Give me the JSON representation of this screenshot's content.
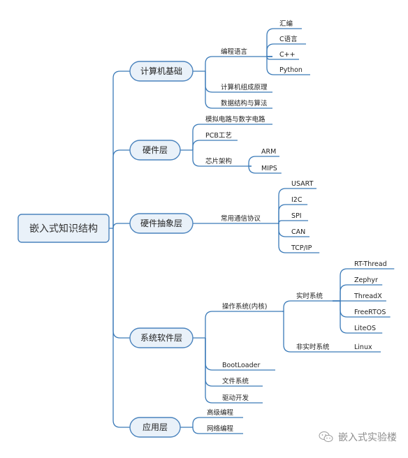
{
  "root": {
    "label": "嵌入式知识结构"
  },
  "branches": [
    {
      "label": "计算机基础",
      "children": [
        {
          "label": "编程语言",
          "children": [
            {
              "label": "汇编"
            },
            {
              "label": "C语言"
            },
            {
              "label": "C++"
            },
            {
              "label": "Python"
            }
          ]
        },
        {
          "label": "计算机组成原理"
        },
        {
          "label": "数据结构与算法"
        }
      ]
    },
    {
      "label": "硬件层",
      "children": [
        {
          "label": "模拟电路与数字电路"
        },
        {
          "label": "PCB工艺"
        },
        {
          "label": "芯片架构",
          "children": [
            {
              "label": "ARM"
            },
            {
              "label": "MIPS"
            }
          ]
        }
      ]
    },
    {
      "label": "硬件抽象层",
      "children": [
        {
          "label": "常用通信协议",
          "children": [
            {
              "label": "USART"
            },
            {
              "label": "I2C"
            },
            {
              "label": "SPI"
            },
            {
              "label": "CAN"
            },
            {
              "label": "TCP/IP"
            }
          ]
        }
      ]
    },
    {
      "label": "系统软件层",
      "children": [
        {
          "label": "操作系统(内核)",
          "children": [
            {
              "label": "实时系统",
              "children": [
                {
                  "label": "RT-Thread"
                },
                {
                  "label": "Zephyr"
                },
                {
                  "label": "ThreadX"
                },
                {
                  "label": "FreeRTOS"
                },
                {
                  "label": "LiteOS"
                }
              ]
            },
            {
              "label": "非实时系统",
              "children": [
                {
                  "label": "Linux"
                }
              ]
            }
          ]
        },
        {
          "label": "BootLoader"
        },
        {
          "label": "文件系统"
        },
        {
          "label": "驱动开发"
        }
      ]
    },
    {
      "label": "应用层",
      "children": [
        {
          "label": "高级编程"
        },
        {
          "label": "网络编程"
        }
      ]
    }
  ],
  "watermark": {
    "icon": "wechat-icon",
    "label": "嵌入式实验楼"
  },
  "colors": {
    "line": "#3a7ab8",
    "box_fill": "#e9f1f9",
    "box_stroke": "#4a83bd",
    "watermark": "#8d8d8d"
  }
}
